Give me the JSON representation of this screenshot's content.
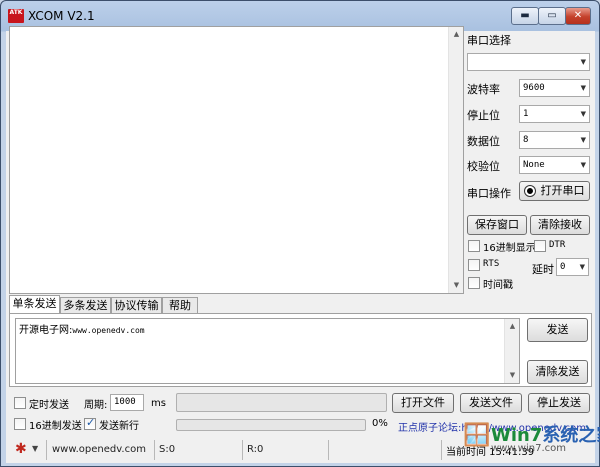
{
  "window": {
    "title": "XCOM V2.1",
    "icon_text": "ATK",
    "min_glyph": "▬",
    "max_glyph": "▭",
    "close_glyph": "✕"
  },
  "side": {
    "port_select_label": "串口选择",
    "port_select_value": "",
    "baud_label": "波特率",
    "baud_value": "9600",
    "stop_label": "停止位",
    "stop_value": "1",
    "data_label": "数据位",
    "data_value": "8",
    "parity_label": "校验位",
    "parity_value": "None",
    "port_op_label": "串口操作",
    "open_port_button": "打开串口",
    "save_window_button": "保存窗口",
    "clear_recv_button": "清除接收",
    "hex_display_label": "16进制显示",
    "dtr_label": "DTR",
    "rts_label": "RTS",
    "delay_label": "延时",
    "delay_value": "0",
    "timestamp_label": "时间戳"
  },
  "tabs": [
    "单条发送",
    "多条发送",
    "协议传输",
    "帮助"
  ],
  "send": {
    "text_cn": "开源电子网:",
    "text_url": "www.openedv.com",
    "send_button": "发送",
    "clear_send_button": "清除发送"
  },
  "controls": {
    "timed_send_label": "定时发送",
    "period_label": "周期:",
    "period_value": "1000",
    "period_unit": "ms",
    "open_file_button": "打开文件",
    "send_file_button": "发送文件",
    "stop_send_button": "停止发送",
    "hex_send_label": "16进制发送",
    "send_newline_label": "发送新行",
    "send_newline_checked": true,
    "progress_percent": "0%"
  },
  "status": {
    "site": "www.openedv.com",
    "send_count": "S:0",
    "recv_count": "R:0",
    "hint": "正点原子论坛:http://www.openedv.com",
    "time": "当前时间 15:41:39"
  },
  "watermark": {
    "title": "系统之家",
    "prefix": "Win7",
    "url": "www.win7.com"
  }
}
